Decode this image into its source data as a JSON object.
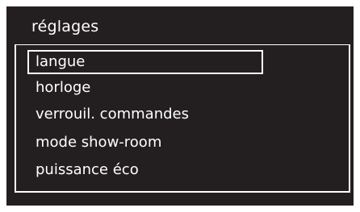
{
  "menu": {
    "title": "réglages",
    "selected_index": 0,
    "items": [
      {
        "label": "langue"
      },
      {
        "label": "horloge"
      },
      {
        "label": "verrouil. commandes"
      },
      {
        "label": "mode show-room"
      },
      {
        "label": "puissance éco"
      }
    ]
  },
  "colors": {
    "background": "#231f20",
    "text": "#ffffff",
    "highlight_border": "#ffffff"
  }
}
